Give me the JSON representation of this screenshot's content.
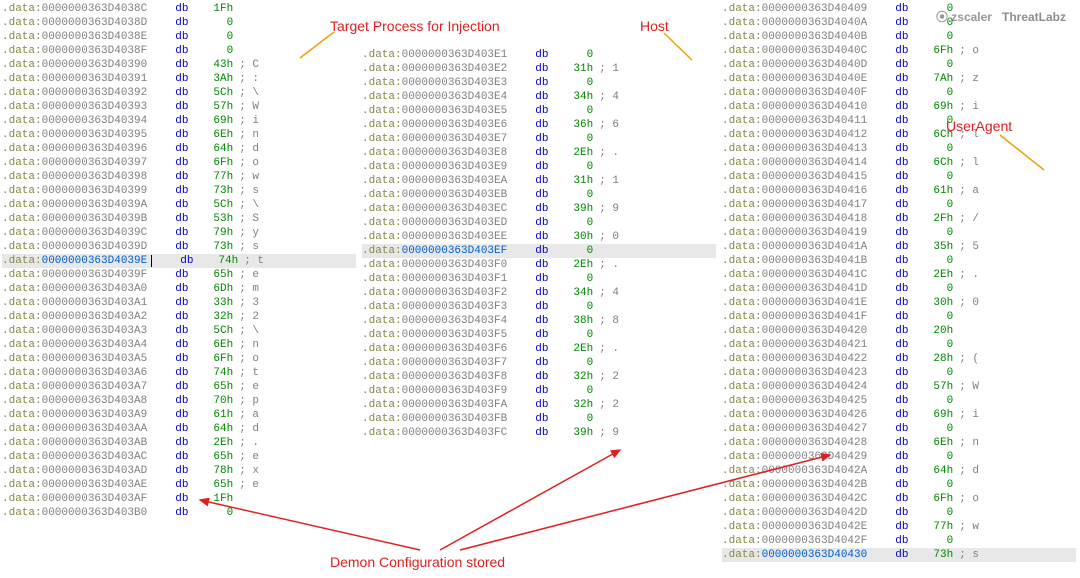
{
  "annotations": {
    "target_process": "Target Process for Injection",
    "host": "Host",
    "user_agent": "UserAgent",
    "demon_config": "Demon Configuration stored"
  },
  "brand": {
    "left": "zscaler",
    "right": "ThreatLabz"
  },
  "col1": [
    {
      "addr": "0000000363D4038C",
      "val": "1Fh",
      "cmt": ""
    },
    {
      "addr": "0000000363D4038D",
      "val": "0",
      "cmt": ""
    },
    {
      "addr": "0000000363D4038E",
      "val": "0",
      "cmt": ""
    },
    {
      "addr": "0000000363D4038F",
      "val": "0",
      "cmt": ""
    },
    {
      "addr": "0000000363D40390",
      "val": "43h",
      "cmt": "; C"
    },
    {
      "addr": "0000000363D40391",
      "val": "3Ah",
      "cmt": "; :"
    },
    {
      "addr": "0000000363D40392",
      "val": "5Ch",
      "cmt": "; \\"
    },
    {
      "addr": "0000000363D40393",
      "val": "57h",
      "cmt": "; W"
    },
    {
      "addr": "0000000363D40394",
      "val": "69h",
      "cmt": "; i"
    },
    {
      "addr": "0000000363D40395",
      "val": "6Eh",
      "cmt": "; n"
    },
    {
      "addr": "0000000363D40396",
      "val": "64h",
      "cmt": "; d"
    },
    {
      "addr": "0000000363D40397",
      "val": "6Fh",
      "cmt": "; o"
    },
    {
      "addr": "0000000363D40398",
      "val": "77h",
      "cmt": "; w"
    },
    {
      "addr": "0000000363D40399",
      "val": "73h",
      "cmt": "; s"
    },
    {
      "addr": "0000000363D4039A",
      "val": "5Ch",
      "cmt": "; \\"
    },
    {
      "addr": "0000000363D4039B",
      "val": "53h",
      "cmt": "; S"
    },
    {
      "addr": "0000000363D4039C",
      "val": "79h",
      "cmt": "; y"
    },
    {
      "addr": "0000000363D4039D",
      "val": "73h",
      "cmt": "; s"
    },
    {
      "addr": "0000000363D4039E",
      "val": "74h",
      "cmt": "; t",
      "hl": true,
      "cursor": true
    },
    {
      "addr": "0000000363D4039F",
      "val": "65h",
      "cmt": "; e"
    },
    {
      "addr": "0000000363D403A0",
      "val": "6Dh",
      "cmt": "; m"
    },
    {
      "addr": "0000000363D403A1",
      "val": "33h",
      "cmt": "; 3"
    },
    {
      "addr": "0000000363D403A2",
      "val": "32h",
      "cmt": "; 2"
    },
    {
      "addr": "0000000363D403A3",
      "val": "5Ch",
      "cmt": "; \\"
    },
    {
      "addr": "0000000363D403A4",
      "val": "6Eh",
      "cmt": "; n"
    },
    {
      "addr": "0000000363D403A5",
      "val": "6Fh",
      "cmt": "; o"
    },
    {
      "addr": "0000000363D403A6",
      "val": "74h",
      "cmt": "; t"
    },
    {
      "addr": "0000000363D403A7",
      "val": "65h",
      "cmt": "; e"
    },
    {
      "addr": "0000000363D403A8",
      "val": "70h",
      "cmt": "; p"
    },
    {
      "addr": "0000000363D403A9",
      "val": "61h",
      "cmt": "; a"
    },
    {
      "addr": "0000000363D403AA",
      "val": "64h",
      "cmt": "; d"
    },
    {
      "addr": "0000000363D403AB",
      "val": "2Eh",
      "cmt": "; ."
    },
    {
      "addr": "0000000363D403AC",
      "val": "65h",
      "cmt": "; e"
    },
    {
      "addr": "0000000363D403AD",
      "val": "78h",
      "cmt": "; x"
    },
    {
      "addr": "0000000363D403AE",
      "val": "65h",
      "cmt": "; e"
    },
    {
      "addr": "0000000363D403AF",
      "val": "1Fh",
      "cmt": ""
    },
    {
      "addr": "0000000363D403B0",
      "val": "0",
      "cmt": ""
    }
  ],
  "col2": [
    {
      "addr": "0000000363D403E1",
      "val": "0",
      "cmt": ""
    },
    {
      "addr": "0000000363D403E2",
      "val": "31h",
      "cmt": "; 1"
    },
    {
      "addr": "0000000363D403E3",
      "val": "0",
      "cmt": ""
    },
    {
      "addr": "0000000363D403E4",
      "val": "34h",
      "cmt": "; 4"
    },
    {
      "addr": "0000000363D403E5",
      "val": "0",
      "cmt": ""
    },
    {
      "addr": "0000000363D403E6",
      "val": "36h",
      "cmt": "; 6"
    },
    {
      "addr": "0000000363D403E7",
      "val": "0",
      "cmt": ""
    },
    {
      "addr": "0000000363D403E8",
      "val": "2Eh",
      "cmt": "; ."
    },
    {
      "addr": "0000000363D403E9",
      "val": "0",
      "cmt": ""
    },
    {
      "addr": "0000000363D403EA",
      "val": "31h",
      "cmt": "; 1"
    },
    {
      "addr": "0000000363D403EB",
      "val": "0",
      "cmt": ""
    },
    {
      "addr": "0000000363D403EC",
      "val": "39h",
      "cmt": "; 9"
    },
    {
      "addr": "0000000363D403ED",
      "val": "0",
      "cmt": ""
    },
    {
      "addr": "0000000363D403EE",
      "val": "30h",
      "cmt": "; 0"
    },
    {
      "addr": "0000000363D403EF",
      "val": "0",
      "cmt": "",
      "hl": true
    },
    {
      "addr": "0000000363D403F0",
      "val": "2Eh",
      "cmt": "; ."
    },
    {
      "addr": "0000000363D403F1",
      "val": "0",
      "cmt": ""
    },
    {
      "addr": "0000000363D403F2",
      "val": "34h",
      "cmt": "; 4"
    },
    {
      "addr": "0000000363D403F3",
      "val": "0",
      "cmt": ""
    },
    {
      "addr": "0000000363D403F4",
      "val": "38h",
      "cmt": "; 8"
    },
    {
      "addr": "0000000363D403F5",
      "val": "0",
      "cmt": ""
    },
    {
      "addr": "0000000363D403F6",
      "val": "2Eh",
      "cmt": "; ."
    },
    {
      "addr": "0000000363D403F7",
      "val": "0",
      "cmt": ""
    },
    {
      "addr": "0000000363D403F8",
      "val": "32h",
      "cmt": "; 2"
    },
    {
      "addr": "0000000363D403F9",
      "val": "0",
      "cmt": ""
    },
    {
      "addr": "0000000363D403FA",
      "val": "32h",
      "cmt": "; 2"
    },
    {
      "addr": "0000000363D403FB",
      "val": "0",
      "cmt": ""
    },
    {
      "addr": "0000000363D403FC",
      "val": "39h",
      "cmt": "; 9"
    }
  ],
  "col3": [
    {
      "addr": "0000000363D40409",
      "val": "0",
      "cmt": ""
    },
    {
      "addr": "0000000363D4040A",
      "val": "0",
      "cmt": ""
    },
    {
      "addr": "0000000363D4040B",
      "val": "0",
      "cmt": ""
    },
    {
      "addr": "0000000363D4040C",
      "val": "6Fh",
      "cmt": "; o"
    },
    {
      "addr": "0000000363D4040D",
      "val": "0",
      "cmt": ""
    },
    {
      "addr": "0000000363D4040E",
      "val": "7Ah",
      "cmt": "; z"
    },
    {
      "addr": "0000000363D4040F",
      "val": "0",
      "cmt": ""
    },
    {
      "addr": "0000000363D40410",
      "val": "69h",
      "cmt": "; i"
    },
    {
      "addr": "0000000363D40411",
      "val": "0",
      "cmt": ""
    },
    {
      "addr": "0000000363D40412",
      "val": "6Ch",
      "cmt": "; l"
    },
    {
      "addr": "0000000363D40413",
      "val": "0",
      "cmt": ""
    },
    {
      "addr": "0000000363D40414",
      "val": "6Ch",
      "cmt": "; l"
    },
    {
      "addr": "0000000363D40415",
      "val": "0",
      "cmt": ""
    },
    {
      "addr": "0000000363D40416",
      "val": "61h",
      "cmt": "; a"
    },
    {
      "addr": "0000000363D40417",
      "val": "0",
      "cmt": ""
    },
    {
      "addr": "0000000363D40418",
      "val": "2Fh",
      "cmt": "; /"
    },
    {
      "addr": "0000000363D40419",
      "val": "0",
      "cmt": ""
    },
    {
      "addr": "0000000363D4041A",
      "val": "35h",
      "cmt": "; 5"
    },
    {
      "addr": "0000000363D4041B",
      "val": "0",
      "cmt": ""
    },
    {
      "addr": "0000000363D4041C",
      "val": "2Eh",
      "cmt": "; ."
    },
    {
      "addr": "0000000363D4041D",
      "val": "0",
      "cmt": ""
    },
    {
      "addr": "0000000363D4041E",
      "val": "30h",
      "cmt": "; 0"
    },
    {
      "addr": "0000000363D4041F",
      "val": "0",
      "cmt": ""
    },
    {
      "addr": "0000000363D40420",
      "val": "20h",
      "cmt": ""
    },
    {
      "addr": "0000000363D40421",
      "val": "0",
      "cmt": ""
    },
    {
      "addr": "0000000363D40422",
      "val": "28h",
      "cmt": "; ("
    },
    {
      "addr": "0000000363D40423",
      "val": "0",
      "cmt": ""
    },
    {
      "addr": "0000000363D40424",
      "val": "57h",
      "cmt": "; W"
    },
    {
      "addr": "0000000363D40425",
      "val": "0",
      "cmt": ""
    },
    {
      "addr": "0000000363D40426",
      "val": "69h",
      "cmt": "; i"
    },
    {
      "addr": "0000000363D40427",
      "val": "0",
      "cmt": ""
    },
    {
      "addr": "0000000363D40428",
      "val": "6Eh",
      "cmt": "; n"
    },
    {
      "addr": "0000000363D40429",
      "val": "0",
      "cmt": ""
    },
    {
      "addr": "0000000363D4042A",
      "val": "64h",
      "cmt": "; d"
    },
    {
      "addr": "0000000363D4042B",
      "val": "0",
      "cmt": ""
    },
    {
      "addr": "0000000363D4042C",
      "val": "6Fh",
      "cmt": "; o"
    },
    {
      "addr": "0000000363D4042D",
      "val": "0",
      "cmt": ""
    },
    {
      "addr": "0000000363D4042E",
      "val": "77h",
      "cmt": "; w"
    },
    {
      "addr": "0000000363D4042F",
      "val": "0",
      "cmt": ""
    },
    {
      "addr": "0000000363D40430",
      "val": "73h",
      "cmt": "; s",
      "hl": true
    }
  ]
}
